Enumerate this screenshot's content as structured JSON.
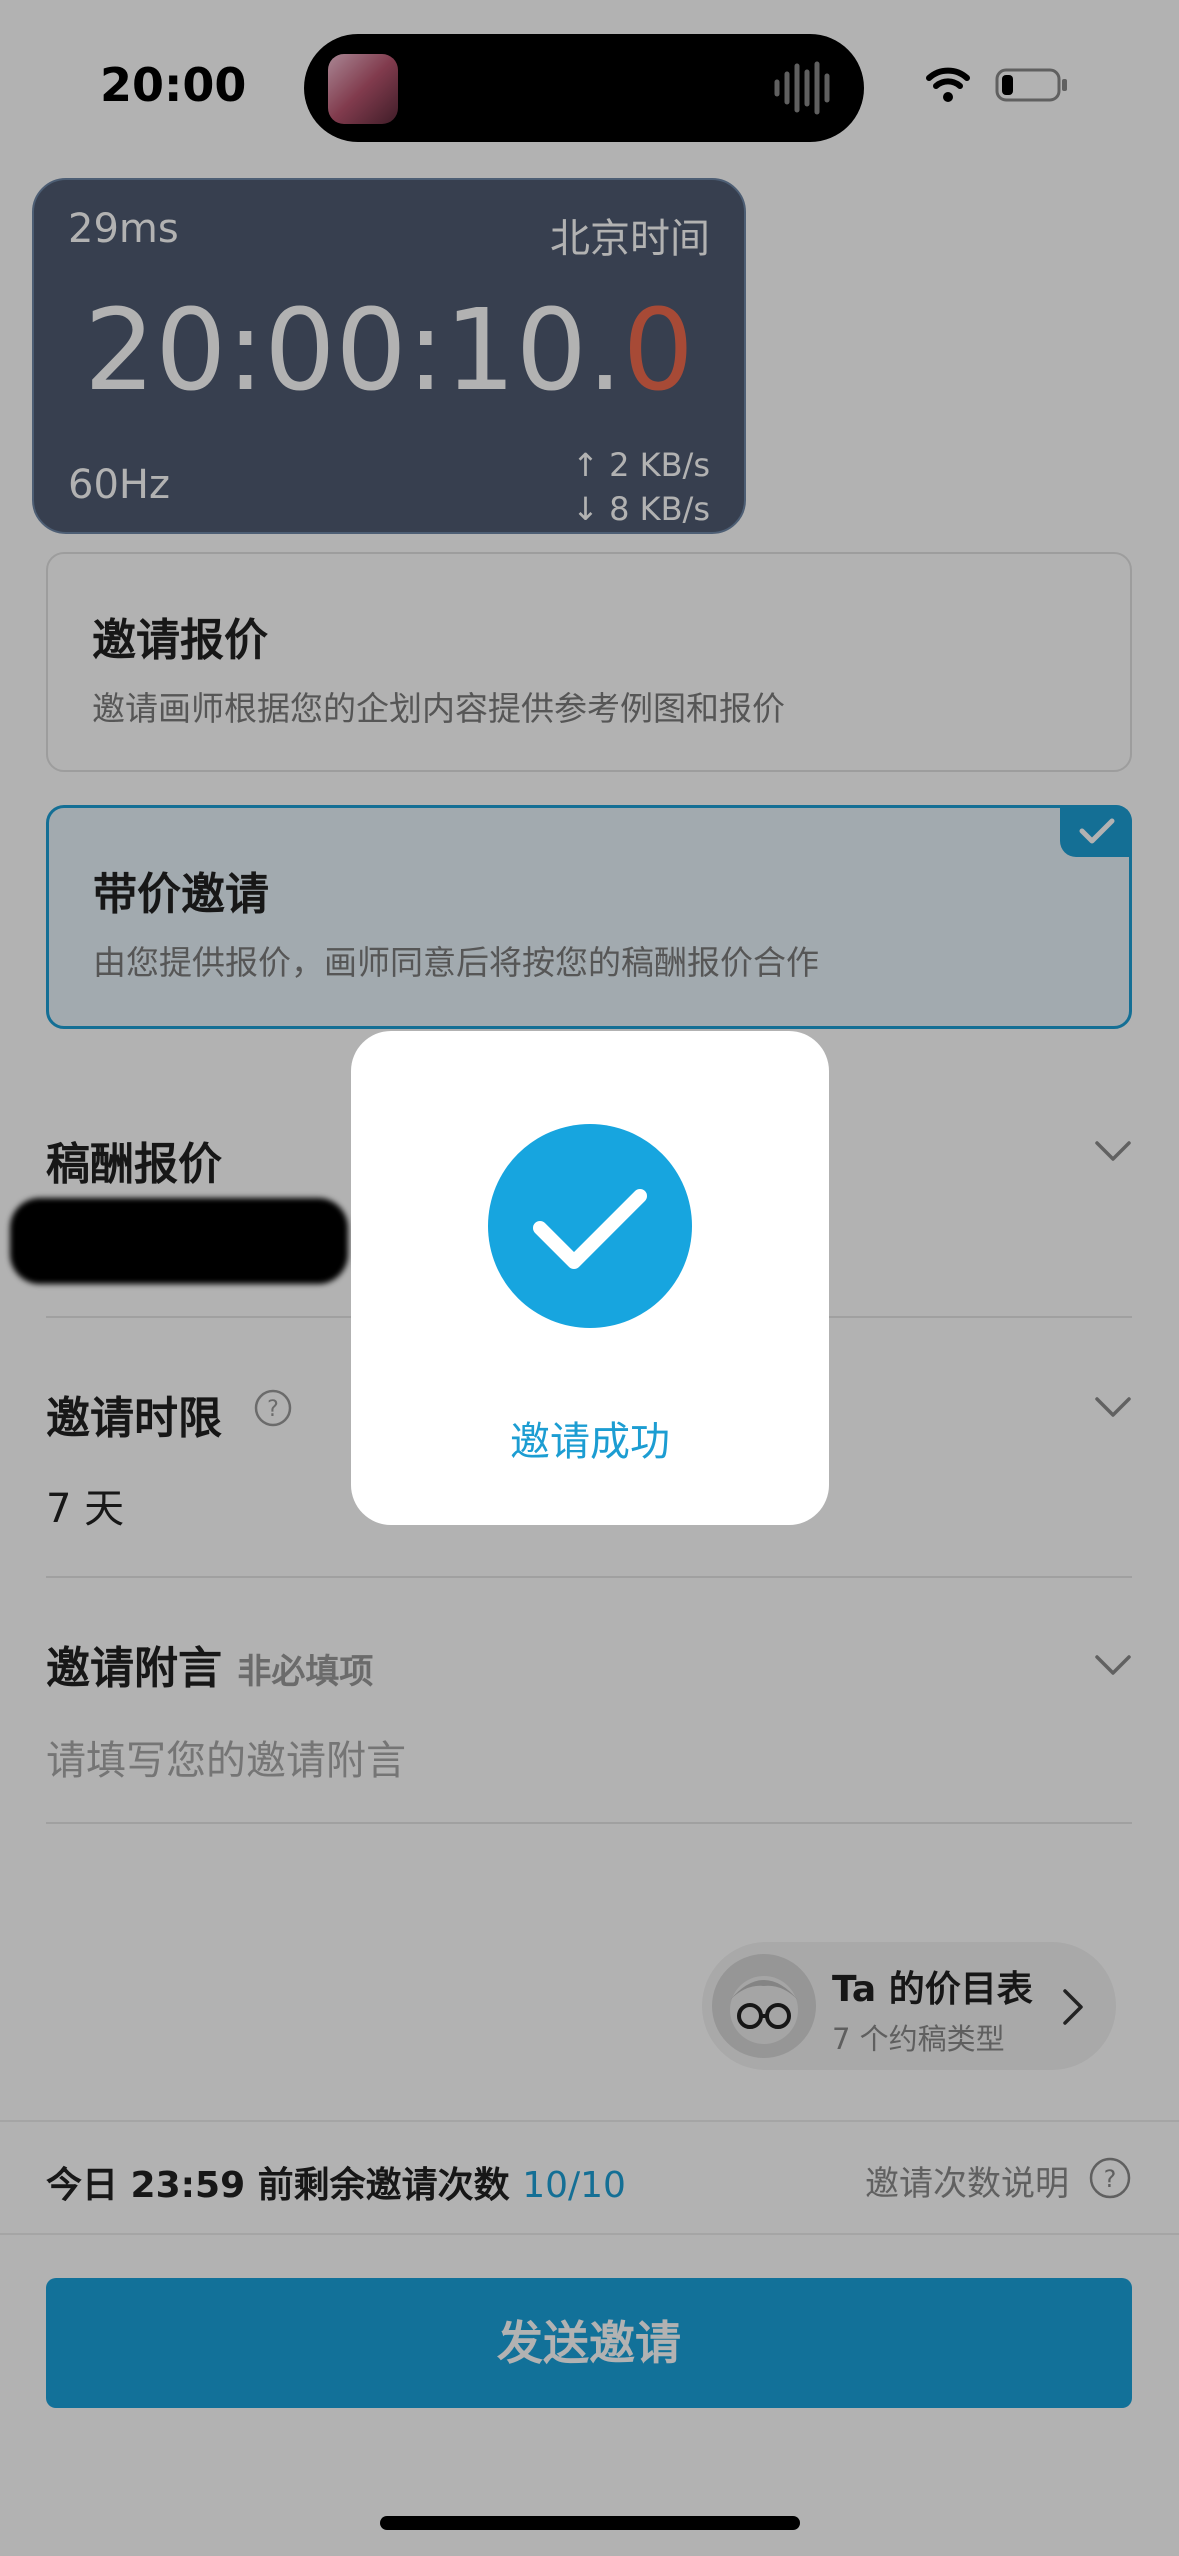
{
  "status_bar": {
    "time": "20:00"
  },
  "clock_widget": {
    "latency": "29ms",
    "timezone": "北京时间",
    "time_main": "20:00:10.",
    "time_tenth": "0",
    "refresh_rate": "60Hz",
    "upload_speed": "↑ 2 KB/s",
    "download_speed": "↓ 8 KB/s"
  },
  "options": [
    {
      "title": "邀请报价",
      "subtitle": "邀请画师根据您的企划内容提供参考例图和报价",
      "selected": false
    },
    {
      "title": "带价邀请",
      "subtitle": "由您提供报价，画师同意后将按您的稿酬报价合作",
      "selected": true
    }
  ],
  "fee_section": {
    "title": "稿酬报价"
  },
  "time_limit_section": {
    "title": "邀请时限",
    "value": "7 天"
  },
  "message_section": {
    "title": "邀请附言",
    "hint": "非必填项",
    "placeholder": "请填写您的邀请附言"
  },
  "price_list": {
    "title": "Ta 的价目表",
    "subtitle": "7 个约稿类型"
  },
  "quota": {
    "label": "今日 23:59 前剩余邀请次数",
    "count": "10/10",
    "help_label": "邀请次数说明"
  },
  "send_button": {
    "label": "发送邀请"
  },
  "toast": {
    "message": "邀请成功"
  },
  "colors": {
    "accent": "#1ba2dc",
    "toast_icon": "#17a5df",
    "tenth_digit": "#f06a4e"
  }
}
